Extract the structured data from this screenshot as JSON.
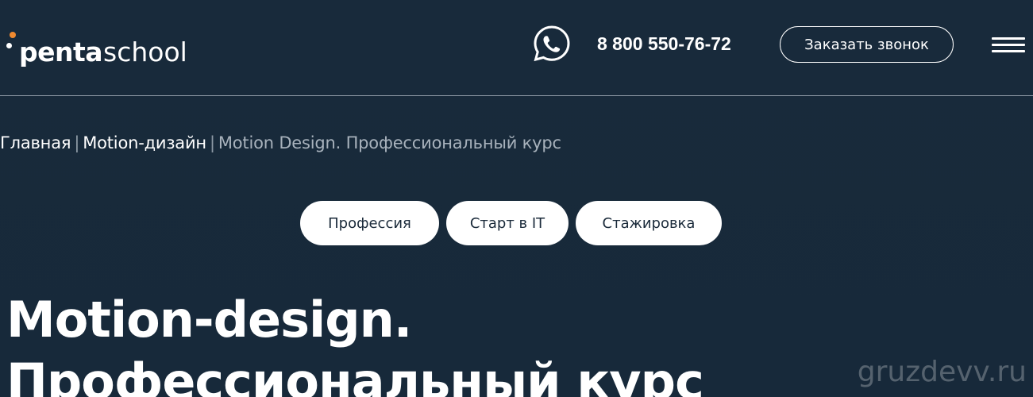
{
  "header": {
    "logo": {
      "penta": "penta",
      "school": "school"
    },
    "phone": "8 800 550-76-72",
    "callback_label": "Заказать звонок",
    "whatsapp_icon": "whatsapp-icon",
    "menu_icon": "hamburger-menu-icon"
  },
  "breadcrumb": {
    "home": "Главная",
    "separator": "|",
    "category": "Motion-дизайн",
    "current": "Motion Design. Профессиональный курс"
  },
  "pills": {
    "profession": "Профессия",
    "start_it": "Старт в IT",
    "internship": "Стажировка"
  },
  "title": {
    "line1": "Motion-design.",
    "line2": "Профессиональный курс"
  },
  "watermark": "gruzdevv.ru",
  "colors": {
    "background": "#18293a",
    "accent_orange": "#f08a30",
    "text": "#ffffff",
    "muted": "#a8b2bc"
  }
}
